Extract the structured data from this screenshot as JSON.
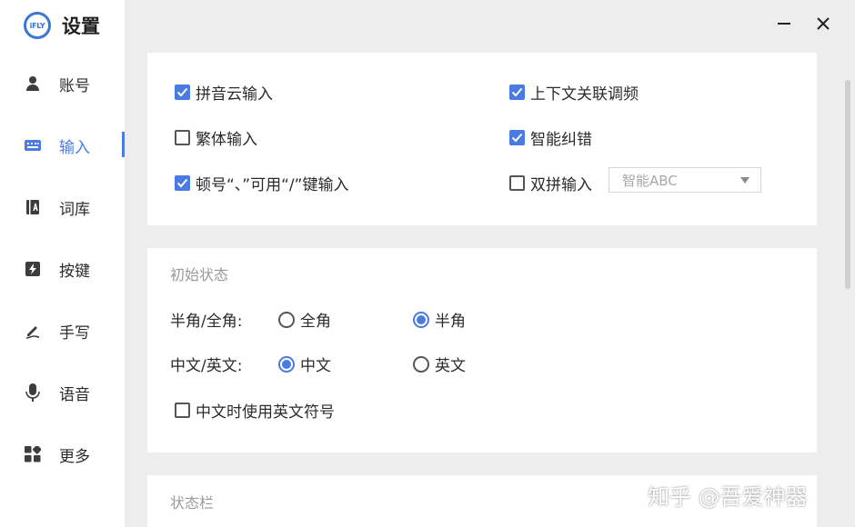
{
  "app": {
    "logo_text": "iFLY",
    "title": "设置"
  },
  "window_controls": {
    "minimize_icon": "minimize-icon",
    "close_icon": "close-icon"
  },
  "sidebar": {
    "items": [
      {
        "label": "账号",
        "icon": "user-icon"
      },
      {
        "label": "输入",
        "icon": "keyboard-icon",
        "active": true
      },
      {
        "label": "词库",
        "icon": "dictionary-icon"
      },
      {
        "label": "按键",
        "icon": "key-icon"
      },
      {
        "label": "手写",
        "icon": "pen-icon"
      },
      {
        "label": "语音",
        "icon": "microphone-icon"
      },
      {
        "label": "更多",
        "icon": "grid-icon"
      }
    ]
  },
  "input_options": {
    "pinyin_cloud": {
      "label": "拼音云输入",
      "checked": true
    },
    "context_freq": {
      "label": "上下文关联调频",
      "checked": true
    },
    "traditional": {
      "label": "繁体输入",
      "checked": false
    },
    "smart_correct": {
      "label": "智能纠错",
      "checked": true
    },
    "slash_key": {
      "label": "顿号“、”可用“/”键输入",
      "checked": true
    },
    "double_pinyin": {
      "label": "双拼输入",
      "checked": false
    },
    "double_pinyin_scheme": "智能ABC"
  },
  "initial_state": {
    "title": "初始状态",
    "width_row": {
      "label": "半角/全角:",
      "options": [
        "全角",
        "半角"
      ],
      "selected": "半角"
    },
    "lang_row": {
      "label": "中文/英文:",
      "options": [
        "中文",
        "英文"
      ],
      "selected": "中文"
    },
    "english_punct": {
      "label": "中文时使用英文符号",
      "checked": false
    }
  },
  "status_bar": {
    "title": "状态栏"
  },
  "watermark": "知乎 @吾爱神器",
  "colors": {
    "accent": "#4a7be0",
    "background": "#ededed",
    "card": "#ffffff"
  }
}
